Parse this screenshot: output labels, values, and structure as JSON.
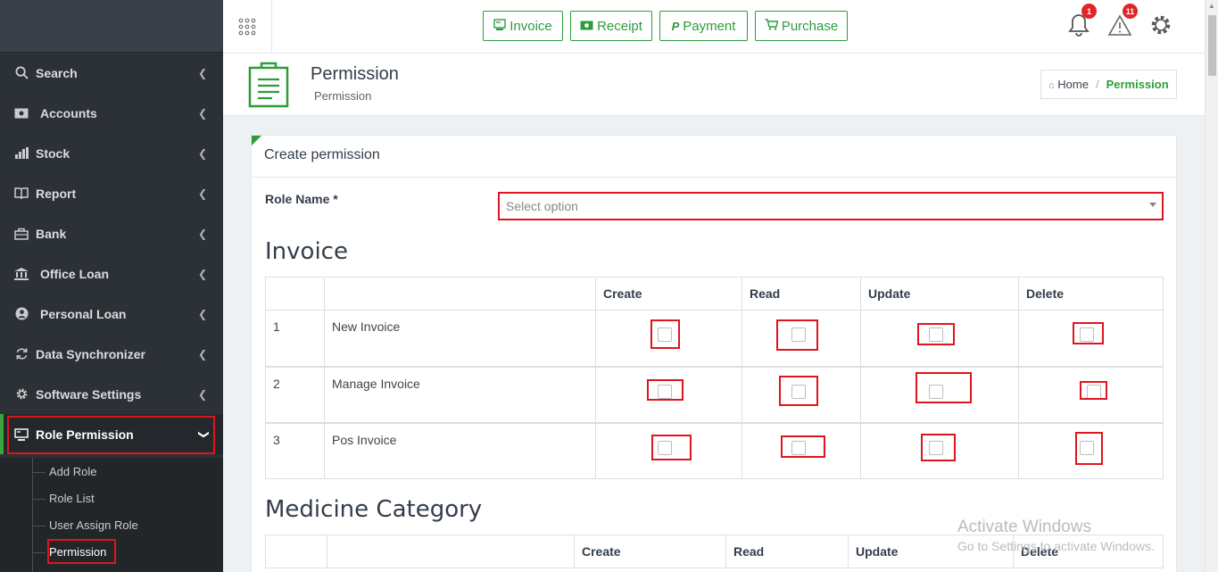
{
  "sidebar": {
    "items": [
      {
        "label": "Search",
        "icon": "search-icon"
      },
      {
        "label": "Accounts",
        "icon": "money-icon"
      },
      {
        "label": "Stock",
        "icon": "bar-chart-icon"
      },
      {
        "label": "Report",
        "icon": "book-icon"
      },
      {
        "label": "Bank",
        "icon": "briefcase-icon"
      },
      {
        "label": "Office Loan",
        "icon": "bank-icon"
      },
      {
        "label": "Personal Loan",
        "icon": "user-circle-icon"
      },
      {
        "label": "Data Synchronizer",
        "icon": "sync-icon"
      },
      {
        "label": "Software Settings",
        "icon": "gear-icon"
      },
      {
        "label": "Role Permission",
        "icon": "desktop-icon"
      }
    ],
    "sub_items": [
      "Add Role",
      "Role List",
      "User Assign Role",
      "Permission"
    ]
  },
  "topbar": {
    "buttons": [
      {
        "label": "Invoice",
        "icon": "invoice-icon"
      },
      {
        "label": "Receipt",
        "icon": "receipt-icon"
      },
      {
        "label": "Payment",
        "icon": "paypal-icon"
      },
      {
        "label": "Purchase",
        "icon": "cart-icon"
      }
    ],
    "notifications_count": "1",
    "alerts_count": "11"
  },
  "header": {
    "title": "Permission",
    "subtitle": "Permission",
    "breadcrumb_home": "Home",
    "breadcrumb_current": "Permission"
  },
  "form": {
    "card_title": "Create permission",
    "role_label": "Role Name *",
    "role_placeholder": "Select option"
  },
  "tables": {
    "columns": [
      "Create",
      "Read",
      "Update",
      "Delete"
    ],
    "invoice": {
      "title": "Invoice",
      "rows": [
        {
          "num": "1",
          "name": "New Invoice"
        },
        {
          "num": "2",
          "name": "Manage Invoice"
        },
        {
          "num": "3",
          "name": "Pos Invoice"
        }
      ]
    },
    "medicine": {
      "title": "Medicine Category"
    }
  },
  "watermark": {
    "line1": "Activate Windows",
    "line2": "Go to Settings to activate Windows."
  },
  "colors": {
    "accent": "#2e9c3c",
    "sidebar": "#2c3136",
    "highlight": "#e0141e"
  }
}
